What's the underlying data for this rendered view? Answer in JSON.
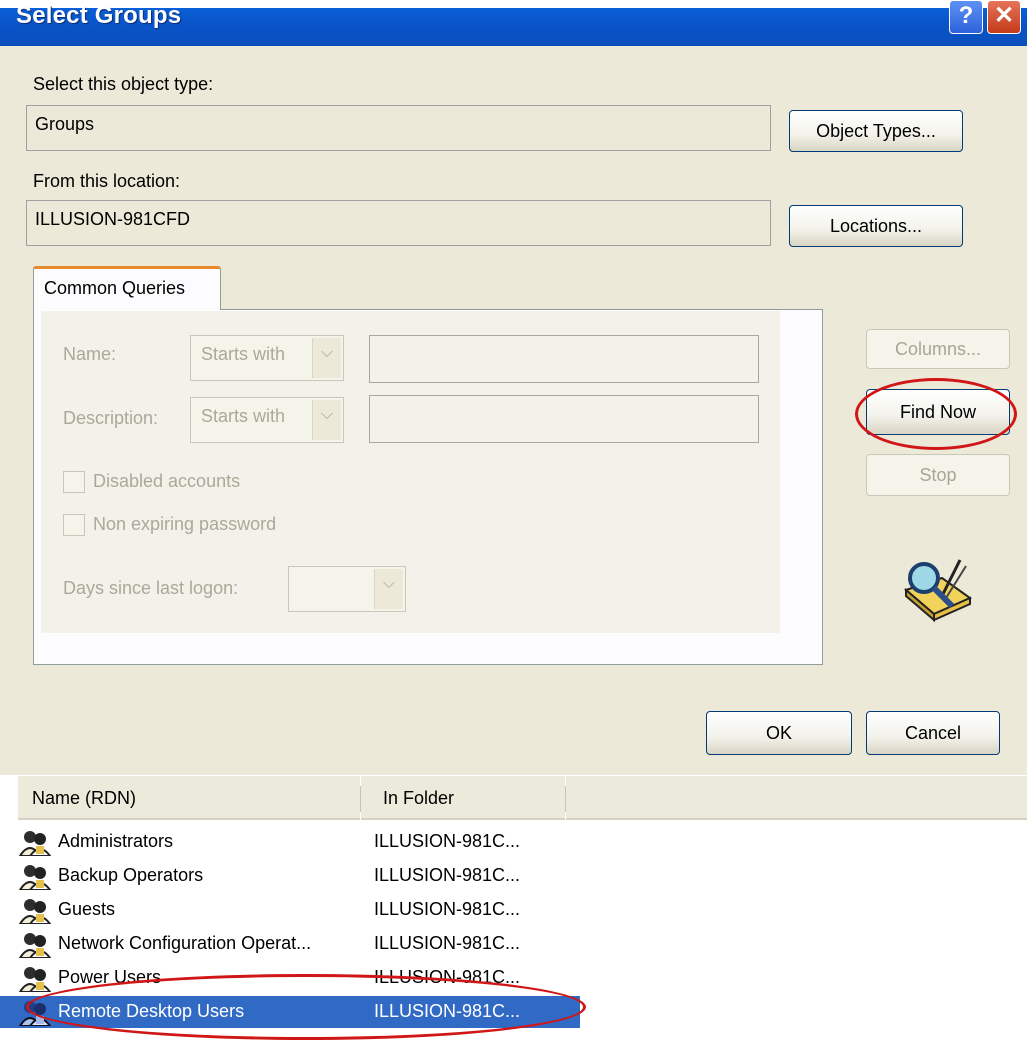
{
  "window": {
    "title": "Select Groups",
    "help_glyph": "?",
    "close_glyph": "✕"
  },
  "object_type": {
    "label": "Select this object type:",
    "value": "Groups",
    "button": "Object Types..."
  },
  "location": {
    "label": "From this location:",
    "value": "ILLUSION-981CFD",
    "button": "Locations..."
  },
  "queries": {
    "tab_label": "Common Queries",
    "name_label": "Name:",
    "name_match": "Starts with",
    "description_label": "Description:",
    "description_match": "Starts with",
    "disabled_accounts_label": "Disabled accounts",
    "non_expiring_label": "Non expiring password",
    "days_label": "Days since last logon:"
  },
  "side_buttons": {
    "columns": "Columns...",
    "find_now": "Find Now",
    "stop": "Stop"
  },
  "actions": {
    "ok": "OK",
    "cancel": "Cancel"
  },
  "results": {
    "columns": [
      "Name (RDN)",
      "In Folder"
    ],
    "rows": [
      {
        "name": "Administrators",
        "folder": "ILLUSION-981C..."
      },
      {
        "name": "Backup Operators",
        "folder": "ILLUSION-981C..."
      },
      {
        "name": "Guests",
        "folder": "ILLUSION-981C..."
      },
      {
        "name": "Network Configuration Operat...",
        "folder": "ILLUSION-981C..."
      },
      {
        "name": "Power Users",
        "folder": "ILLUSION-981C..."
      },
      {
        "name": "Remote Desktop Users",
        "folder": "ILLUSION-981C...",
        "selected": true
      }
    ]
  },
  "colors": {
    "selection": "#316ac5",
    "annotation": "#d01616",
    "titlebar": "#0a5fd8"
  }
}
